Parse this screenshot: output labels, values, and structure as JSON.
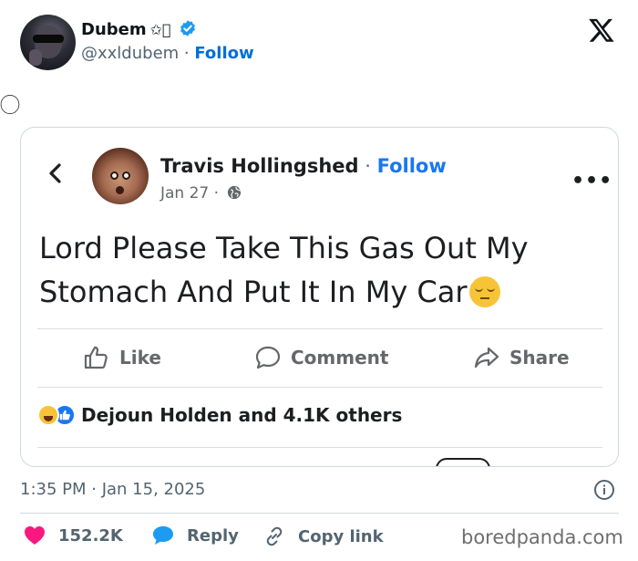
{
  "tweet": {
    "author": {
      "display_name": "Dubem",
      "name_emoji": "✩⃝",
      "handle": "@xxldubem",
      "separator": " · ",
      "follow_label": "Follow"
    },
    "text": "⃝",
    "timestamp": "1:35 PM · Jan 15, 2025",
    "stats": {
      "likes": "152.2K",
      "reply_label": "Reply",
      "copy_link_label": "Copy link"
    }
  },
  "embedded_post": {
    "author": "Travis Hollingshed",
    "separator": " · ",
    "follow_label": "Follow",
    "date": "Jan 27 ·",
    "text": "Lord Please Take This Gas Out My Stomach And Put It In My Car",
    "actions": {
      "like": "Like",
      "comment": "Comment",
      "share": "Share"
    },
    "reactions_text": "Dejoun Holden and 4.1K others"
  },
  "watermark": "boredpanda.com",
  "colors": {
    "verified": "#1d9bf0",
    "follow": "#006fd6",
    "fb_follow": "#1877f2",
    "like_heart": "#f91880",
    "reply_bubble": "#1d9bf0"
  }
}
